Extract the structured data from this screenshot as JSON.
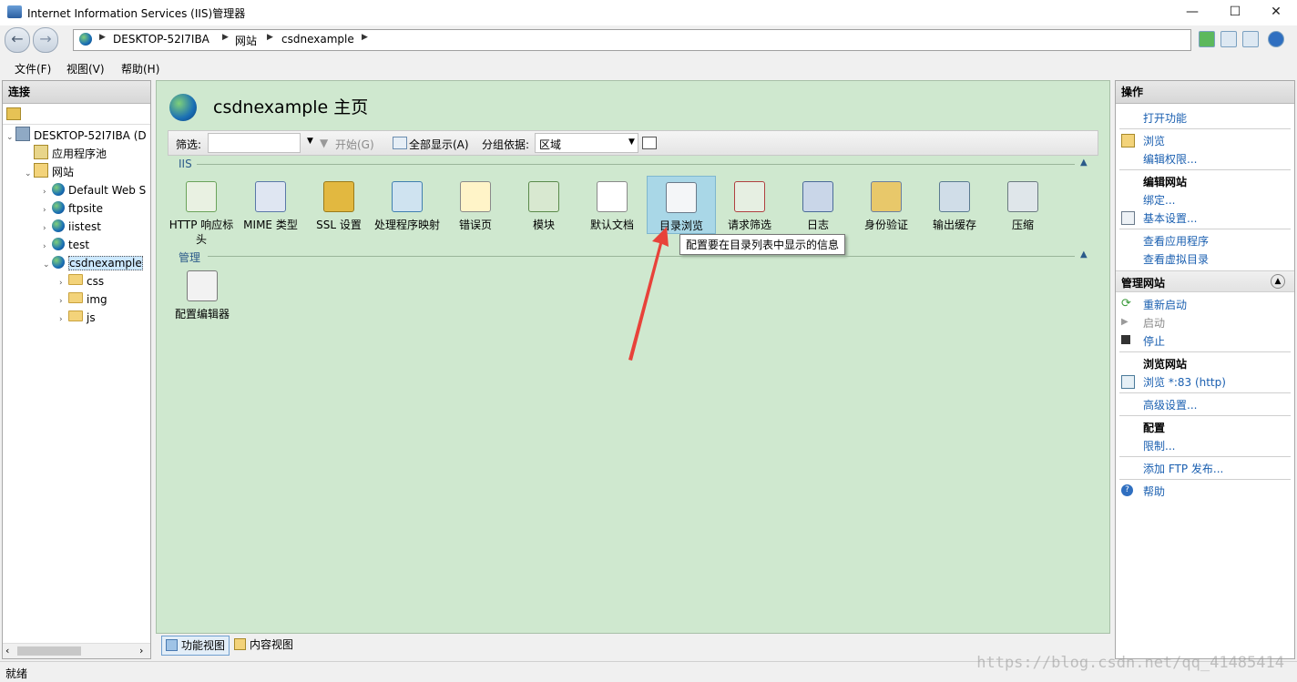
{
  "window": {
    "title": "Internet Information Services (IIS)管理器"
  },
  "address": {
    "segments": [
      "DESKTOP-52I7IBA",
      "网站",
      "csdnexample"
    ]
  },
  "menu": {
    "items": [
      "文件(F)",
      "视图(V)",
      "帮助(H)"
    ]
  },
  "connections": {
    "header": "连接",
    "tree": {
      "server": "DESKTOP-52I7IBA (D",
      "app_pools": "应用程序池",
      "sites": "网站",
      "site_default": "Default Web S",
      "site_ftp": "ftpsite",
      "site_iis": "iistest",
      "site_test": "test",
      "site_selected": "csdnexample",
      "folders": [
        "css",
        "img",
        "js"
      ]
    }
  },
  "main": {
    "title": "csdnexample 主页",
    "filter": {
      "label": "筛选:",
      "start": "开始(G)",
      "show_all": "全部显示(A)",
      "group_label": "分组依据:",
      "group_value": "区域"
    },
    "section_iis": "IIS",
    "section_manage": "管理",
    "features": [
      "HTTP 响应标头",
      "MIME 类型",
      "SSL 设置",
      "处理程序映射",
      "错误页",
      "模块",
      "默认文档",
      "目录浏览",
      "请求筛选",
      "日志",
      "身份验证",
      "输出缓存",
      "压缩"
    ],
    "manage_features": [
      "配置编辑器"
    ],
    "tooltip": "配置要在目录列表中显示的信息"
  },
  "views": {
    "features_view": "功能视图",
    "content_view": "内容视图"
  },
  "actions": {
    "header": "操作",
    "open_feature": "打开功能",
    "explore": "浏览",
    "edit_permissions": "编辑权限...",
    "edit_site_head": "编辑网站",
    "bindings": "绑定...",
    "basic_settings": "基本设置...",
    "view_apps": "查看应用程序",
    "view_vdirs": "查看虚拟目录",
    "manage_site_head": "管理网站",
    "restart": "重新启动",
    "start": "启动",
    "stop": "停止",
    "browse_site_head": "浏览网站",
    "browse_port": "浏览 *:83 (http)",
    "advanced": "高级设置...",
    "configure_head": "配置",
    "limits": "限制...",
    "add_ftp": "添加 FTP 发布...",
    "help": "帮助"
  },
  "status": {
    "text": "就绪"
  },
  "watermark": "https://blog.csdn.net/qq_41485414",
  "colors": {
    "content_bg": "#cfe8cf",
    "link": "#1a5fb0",
    "highlight": "#a9d7e7",
    "arrow": "#e8423a"
  }
}
